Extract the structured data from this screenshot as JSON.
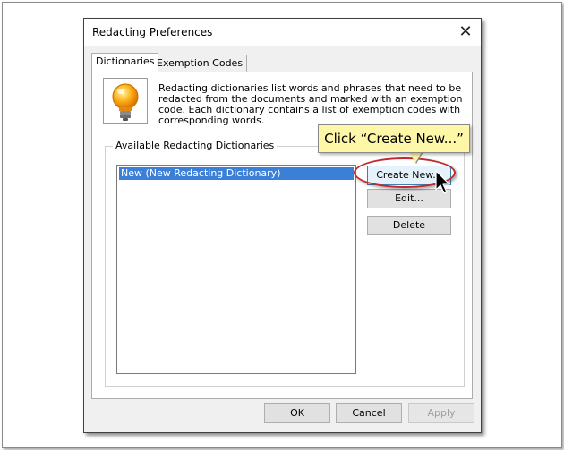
{
  "dialog": {
    "title": "Redacting Preferences",
    "close_label": "✕"
  },
  "tabs": [
    {
      "label": "Dictionaries",
      "active": true
    },
    {
      "label": "Exemption Codes",
      "active": false
    }
  ],
  "description": "Redacting dictionaries list words and phrases that need to be redacted from the documents and marked with an exemption code. Each dictionary contains a list of exemption codes with corresponding words.",
  "group": {
    "label": "Available Redacting Dictionaries",
    "items": [
      "New (New Redacting Dictionary)"
    ]
  },
  "buttons": {
    "create_new": "Create New...",
    "edit": "Edit...",
    "delete": "Delete",
    "ok": "OK",
    "cancel": "Cancel",
    "apply": "Apply"
  },
  "callout": {
    "text": "Click “Create New...”"
  },
  "icons": {
    "lightbulb": "lightbulb-icon",
    "cursor": "mouse-pointer-icon",
    "close": "close-icon"
  },
  "colors": {
    "selection": "#3b7fd7",
    "callout_fill": "#fff7a8",
    "highlight_ring": "#c0282e"
  }
}
